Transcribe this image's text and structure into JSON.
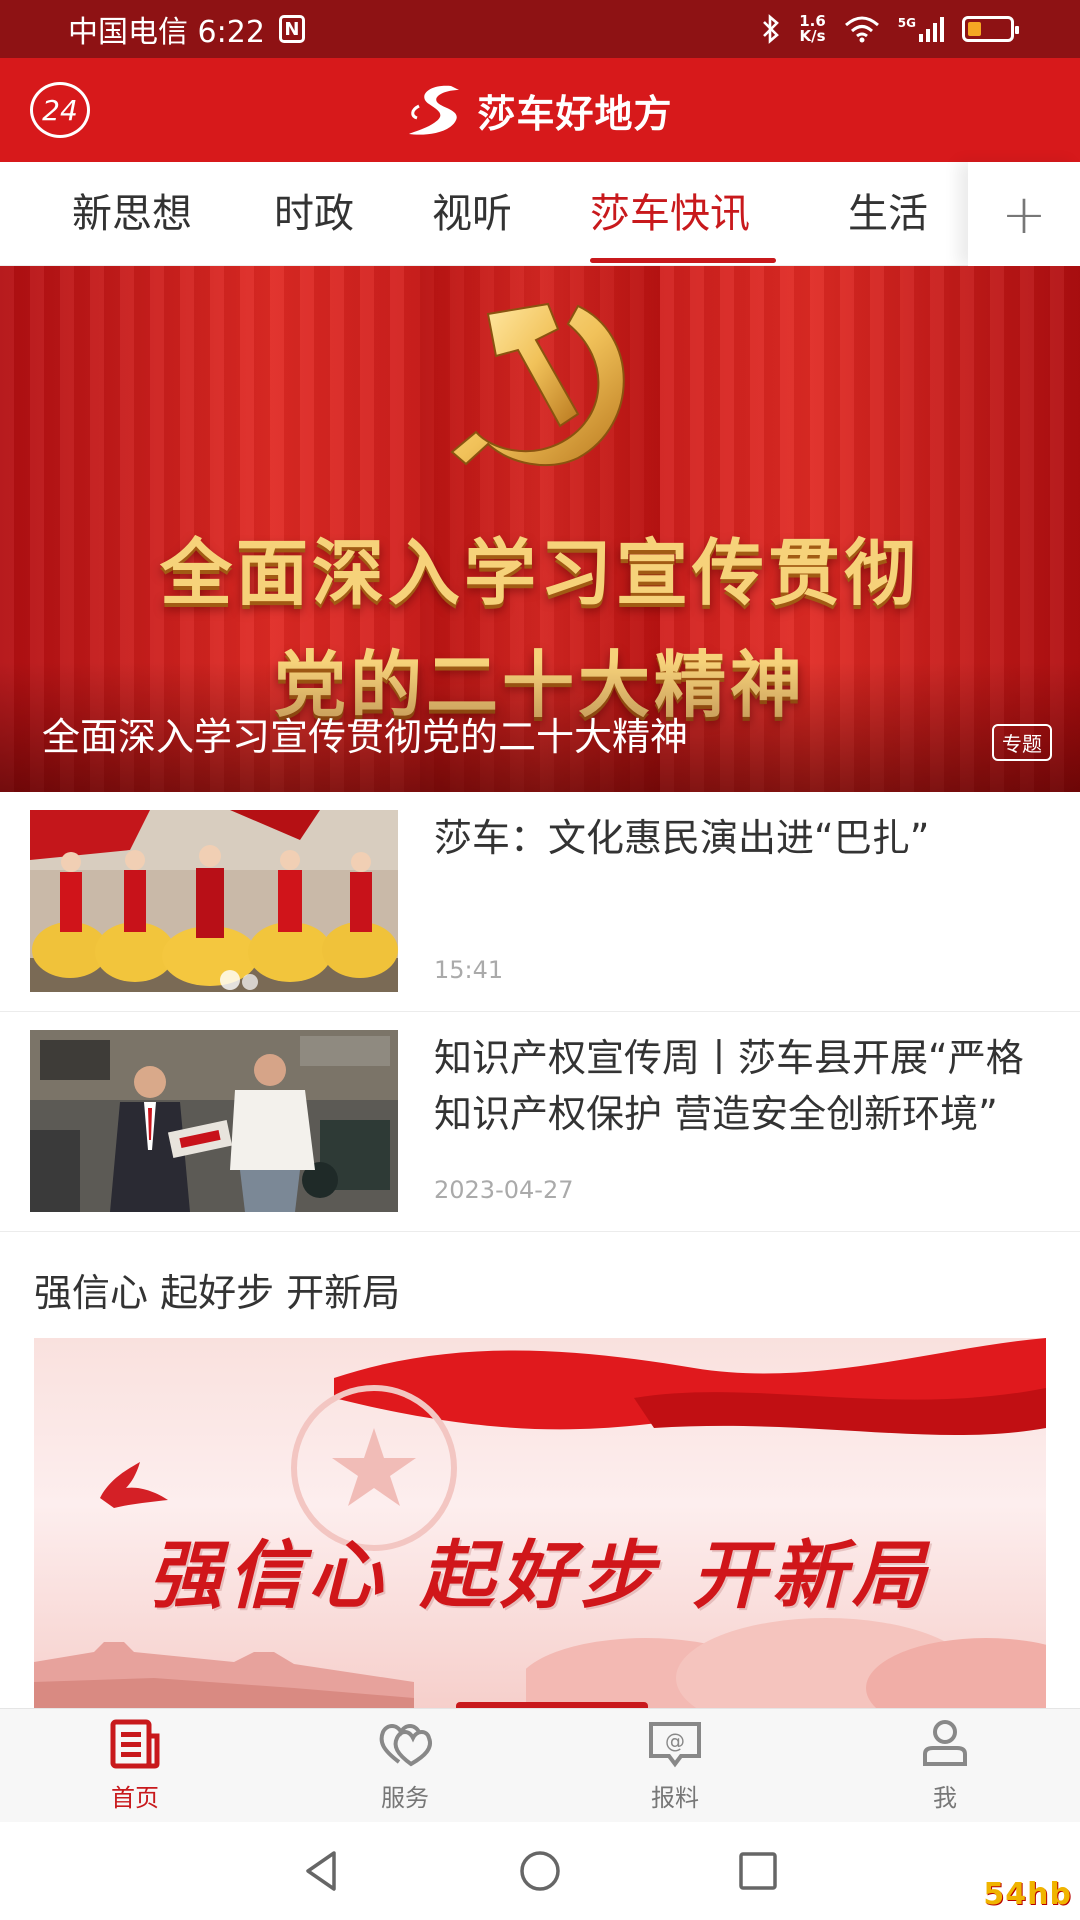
{
  "status_bar": {
    "carrier_time": "中国电信 6:22",
    "nfc": "N",
    "speed_value": "1.6",
    "speed_unit": "K/s",
    "signal_label": "5G"
  },
  "header": {
    "badge": "24",
    "app_name": "莎车好地方"
  },
  "tabs": [
    {
      "label": "新思想"
    },
    {
      "label": "时政"
    },
    {
      "label": "视听"
    },
    {
      "label": "莎车快讯"
    },
    {
      "label": "生活"
    }
  ],
  "active_tab": "莎车快讯",
  "tab_add_label": "+",
  "hero": {
    "banner_line1": "全面深入学习宣传贯彻",
    "banner_line2": "党的二十大精神",
    "caption": "全面深入学习宣传贯彻党的二十大精神",
    "tag": "专题"
  },
  "news": [
    {
      "title": "莎车：文化惠民演出进“巴扎”",
      "time": "15:41"
    },
    {
      "title": "知识产权宣传周丨莎车县开展“严格知识产权保护 营造安全创新环境”",
      "time": "2023-04-27"
    }
  ],
  "section": {
    "title": "强信心 起好步 开新局",
    "banner_text": "强信心 起好步 开新局"
  },
  "bottom_nav": [
    {
      "label": "首页",
      "icon": "news-icon",
      "active": true
    },
    {
      "label": "服务",
      "icon": "heart-icon",
      "active": false
    },
    {
      "label": "报料",
      "icon": "at-message-icon",
      "active": false
    },
    {
      "label": "我",
      "icon": "user-icon",
      "active": false
    }
  ],
  "watermark": "54hb",
  "colors": {
    "brand_red": "#d7191b",
    "status_bar": "#8e1214",
    "active_text": "#c8191c"
  }
}
